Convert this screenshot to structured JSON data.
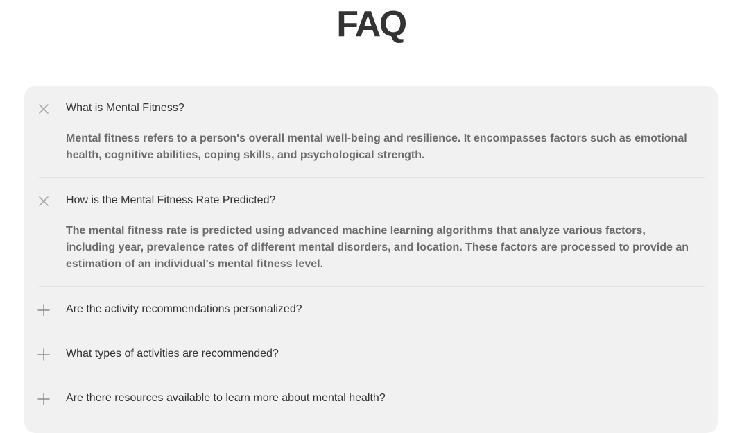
{
  "page": {
    "title": "FAQ"
  },
  "faq": {
    "items": [
      {
        "question": "What is Mental Fitness?",
        "answer": "Mental fitness refers to a person's overall mental well-being and resilience. It encompasses factors such as emotional health, cognitive abilities, coping skills, and psychological strength.",
        "expanded": true,
        "icon": "close-icon"
      },
      {
        "question": "How is the Mental Fitness Rate Predicted?",
        "answer": "The mental fitness rate is predicted using advanced machine learning algorithms that analyze various factors, including year, prevalence rates of different mental disorders, and location. These factors are processed to provide an estimation of an individual's mental fitness level.",
        "expanded": true,
        "icon": "close-icon"
      },
      {
        "question": "Are the activity recommendations personalized?",
        "expanded": false,
        "icon": "plus-icon"
      },
      {
        "question": "What types of activities are recommended?",
        "expanded": false,
        "icon": "plus-icon"
      },
      {
        "question": "Are there resources available to learn more about mental health?",
        "expanded": false,
        "icon": "plus-icon"
      }
    ]
  },
  "colors": {
    "card_background": "#f1f1f1",
    "question_text": "#333333",
    "answer_text": "#6b6b6b",
    "icon_close": "#a8a8a8",
    "icon_plus": "#8a8a8a",
    "divider": "#e2e2e2"
  }
}
